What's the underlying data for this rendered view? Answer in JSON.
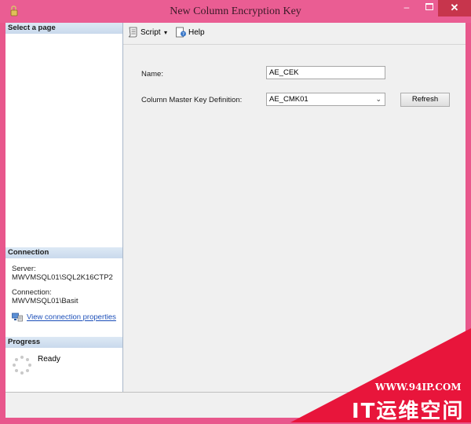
{
  "window": {
    "title": "New Column Encryption Key",
    "minimize_glyph": "–",
    "close_glyph": "✕",
    "colors": {
      "titlebar": "#ea5d93",
      "close_button": "#c7354c"
    }
  },
  "sidebar": {
    "select_page_header": "Select a page",
    "connection": {
      "header": "Connection",
      "server_label": "Server:",
      "server_value": "MWVMSQL01\\SQL2K16CTP2",
      "connection_label": "Connection:",
      "connection_value": "MWVMSQL01\\Basit",
      "view_properties_link": "View connection properties"
    },
    "progress": {
      "header": "Progress",
      "status": "Ready"
    }
  },
  "toolbar": {
    "script_label": "Script",
    "dropdown_glyph": "▾",
    "help_label": "Help"
  },
  "form": {
    "name_label": "Name:",
    "name_value": "AE_CEK",
    "cmk_label": "Column Master Key Definition:",
    "cmk_selected": "AE_CMK01",
    "cmk_chevron": "⌄",
    "refresh_label": "Refresh"
  },
  "watermark": {
    "url": "WWW.94IP.COM",
    "text": "IT运维空间",
    "color": "#e8153b"
  }
}
